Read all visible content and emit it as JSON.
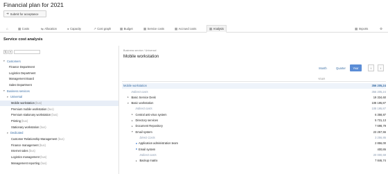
{
  "header": {
    "title": "Financial plan for 2021",
    "submit_label": "Submit for acceptance"
  },
  "tabs": [
    {
      "label": "",
      "icon": "home-icon"
    },
    {
      "label": "Costs",
      "icon": "costs-icon"
    },
    {
      "label": "Allocation",
      "icon": "allocation-icon"
    },
    {
      "label": "Capacity",
      "icon": "capacity-icon"
    },
    {
      "label": "Cost graph",
      "icon": "graph-icon"
    },
    {
      "label": "Budget",
      "icon": "budget-icon"
    },
    {
      "label": "Service costs",
      "icon": "service-costs-icon"
    },
    {
      "label": "Accrued costs",
      "icon": "accrued-icon"
    },
    {
      "label": "Analysis",
      "icon": "analysis-icon",
      "active": true
    },
    {
      "label": "Imports",
      "icon": "imports-icon"
    },
    {
      "label": "",
      "icon": "settings-icon"
    }
  ],
  "left": {
    "section_title": "Service cost analysis",
    "toolbar": {
      "btn1": "⇅",
      "btn2": "≡"
    },
    "tree": [
      {
        "label": "Customers",
        "level": 0,
        "group": true,
        "ext": ""
      },
      {
        "label": "Finance Department",
        "level": 1,
        "ext": ""
      },
      {
        "label": "Logistics Department",
        "level": 1,
        "ext": ""
      },
      {
        "label": "Management Board",
        "level": 1,
        "ext": ""
      },
      {
        "label": "Sales Department",
        "level": 1,
        "ext": ""
      },
      {
        "label": "Business services",
        "level": 0,
        "group": true,
        "ext": ""
      },
      {
        "label": "Universal",
        "level": 1,
        "group": true,
        "ext": ""
      },
      {
        "label": "Mobile workstation",
        "level": 2,
        "ext": "(bus)",
        "selected": true
      },
      {
        "label": "Premium mobile workstation",
        "level": 2,
        "ext": "(bus)"
      },
      {
        "label": "Premium stationary workstation",
        "level": 2,
        "ext": "(bus)"
      },
      {
        "label": "Printing",
        "level": 2,
        "ext": "(bus)"
      },
      {
        "label": "Stationary workstation",
        "level": 2,
        "ext": "(bus)"
      },
      {
        "label": "Dedicated",
        "level": 1,
        "group": true,
        "ext": ""
      },
      {
        "label": "Customer Relationship Management",
        "level": 2,
        "ext": "(bus)"
      },
      {
        "label": "Finance management",
        "level": 2,
        "ext": "(bus)"
      },
      {
        "label": "Internet sales",
        "level": 2,
        "ext": "(bus)"
      },
      {
        "label": "Logistics management",
        "level": 2,
        "ext": "(bus)"
      },
      {
        "label": "Management reporting",
        "level": 2,
        "ext": "(bus)"
      }
    ]
  },
  "right": {
    "breadcrumb": "Business service / Universal",
    "title": "Mobile workstation",
    "periods": [
      "Month",
      "Quarter",
      "Year"
    ],
    "active_period": "Year",
    "prev": "‹",
    "next": "›",
    "column_header": "YEAR",
    "rows": [
      {
        "label": "Mobile workstation",
        "level": 0,
        "type": "main",
        "value": "356 205,24"
      },
      {
        "label": "Indirect costs",
        "level": 1,
        "type": "sub",
        "value": "356 205,24"
      },
      {
        "label": "Basic Service Desk",
        "level": 1,
        "toggle": "▸",
        "value": "19 334,60"
      },
      {
        "label": "Basic workstation",
        "level": 1,
        "toggle": "▾",
        "value": "108 195,87"
      },
      {
        "label": "Indirect costs",
        "level": 2,
        "type": "sub",
        "value": "108 195,87"
      },
      {
        "label": "Central anti-virus system",
        "level": 2,
        "toggle": "▸",
        "value": "6 358,87"
      },
      {
        "label": "Directory services",
        "level": 2,
        "toggle": "▸",
        "value": "5 731,13"
      },
      {
        "label": "Document Repository",
        "level": 2,
        "toggle": "▸",
        "value": "7 698,79"
      },
      {
        "label": "Email system",
        "level": 2,
        "toggle": "▾",
        "value": "23 257,55"
      },
      {
        "label": "Direct Costs",
        "level": 3,
        "type": "sub",
        "value": "3 256,86"
      },
      {
        "label": "Application administration team",
        "level": 3,
        "dot": true,
        "value": "2 856,00"
      },
      {
        "label": "Email system",
        "level": 3,
        "dot": true,
        "value": "400,86"
      },
      {
        "label": "Indirect costs",
        "level": 3,
        "type": "sub",
        "value": "20 000,69"
      },
      {
        "label": "Backup matrix",
        "level": 3,
        "toggle": "▸",
        "value": "7 846,74"
      }
    ]
  }
}
